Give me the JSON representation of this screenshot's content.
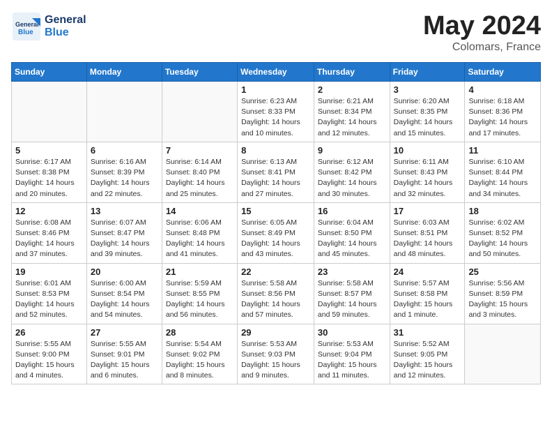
{
  "logo": {
    "general": "General",
    "blue": "Blue"
  },
  "title": "May 2024",
  "location": "Colomars, France",
  "weekdays": [
    "Sunday",
    "Monday",
    "Tuesday",
    "Wednesday",
    "Thursday",
    "Friday",
    "Saturday"
  ],
  "weeks": [
    [
      {
        "day": "",
        "info": ""
      },
      {
        "day": "",
        "info": ""
      },
      {
        "day": "",
        "info": ""
      },
      {
        "day": "1",
        "info": "Sunrise: 6:23 AM\nSunset: 8:33 PM\nDaylight: 14 hours\nand 10 minutes."
      },
      {
        "day": "2",
        "info": "Sunrise: 6:21 AM\nSunset: 8:34 PM\nDaylight: 14 hours\nand 12 minutes."
      },
      {
        "day": "3",
        "info": "Sunrise: 6:20 AM\nSunset: 8:35 PM\nDaylight: 14 hours\nand 15 minutes."
      },
      {
        "day": "4",
        "info": "Sunrise: 6:18 AM\nSunset: 8:36 PM\nDaylight: 14 hours\nand 17 minutes."
      }
    ],
    [
      {
        "day": "5",
        "info": "Sunrise: 6:17 AM\nSunset: 8:38 PM\nDaylight: 14 hours\nand 20 minutes."
      },
      {
        "day": "6",
        "info": "Sunrise: 6:16 AM\nSunset: 8:39 PM\nDaylight: 14 hours\nand 22 minutes."
      },
      {
        "day": "7",
        "info": "Sunrise: 6:14 AM\nSunset: 8:40 PM\nDaylight: 14 hours\nand 25 minutes."
      },
      {
        "day": "8",
        "info": "Sunrise: 6:13 AM\nSunset: 8:41 PM\nDaylight: 14 hours\nand 27 minutes."
      },
      {
        "day": "9",
        "info": "Sunrise: 6:12 AM\nSunset: 8:42 PM\nDaylight: 14 hours\nand 30 minutes."
      },
      {
        "day": "10",
        "info": "Sunrise: 6:11 AM\nSunset: 8:43 PM\nDaylight: 14 hours\nand 32 minutes."
      },
      {
        "day": "11",
        "info": "Sunrise: 6:10 AM\nSunset: 8:44 PM\nDaylight: 14 hours\nand 34 minutes."
      }
    ],
    [
      {
        "day": "12",
        "info": "Sunrise: 6:08 AM\nSunset: 8:46 PM\nDaylight: 14 hours\nand 37 minutes."
      },
      {
        "day": "13",
        "info": "Sunrise: 6:07 AM\nSunset: 8:47 PM\nDaylight: 14 hours\nand 39 minutes."
      },
      {
        "day": "14",
        "info": "Sunrise: 6:06 AM\nSunset: 8:48 PM\nDaylight: 14 hours\nand 41 minutes."
      },
      {
        "day": "15",
        "info": "Sunrise: 6:05 AM\nSunset: 8:49 PM\nDaylight: 14 hours\nand 43 minutes."
      },
      {
        "day": "16",
        "info": "Sunrise: 6:04 AM\nSunset: 8:50 PM\nDaylight: 14 hours\nand 45 minutes."
      },
      {
        "day": "17",
        "info": "Sunrise: 6:03 AM\nSunset: 8:51 PM\nDaylight: 14 hours\nand 48 minutes."
      },
      {
        "day": "18",
        "info": "Sunrise: 6:02 AM\nSunset: 8:52 PM\nDaylight: 14 hours\nand 50 minutes."
      }
    ],
    [
      {
        "day": "19",
        "info": "Sunrise: 6:01 AM\nSunset: 8:53 PM\nDaylight: 14 hours\nand 52 minutes."
      },
      {
        "day": "20",
        "info": "Sunrise: 6:00 AM\nSunset: 8:54 PM\nDaylight: 14 hours\nand 54 minutes."
      },
      {
        "day": "21",
        "info": "Sunrise: 5:59 AM\nSunset: 8:55 PM\nDaylight: 14 hours\nand 56 minutes."
      },
      {
        "day": "22",
        "info": "Sunrise: 5:58 AM\nSunset: 8:56 PM\nDaylight: 14 hours\nand 57 minutes."
      },
      {
        "day": "23",
        "info": "Sunrise: 5:58 AM\nSunset: 8:57 PM\nDaylight: 14 hours\nand 59 minutes."
      },
      {
        "day": "24",
        "info": "Sunrise: 5:57 AM\nSunset: 8:58 PM\nDaylight: 15 hours\nand 1 minute."
      },
      {
        "day": "25",
        "info": "Sunrise: 5:56 AM\nSunset: 8:59 PM\nDaylight: 15 hours\nand 3 minutes."
      }
    ],
    [
      {
        "day": "26",
        "info": "Sunrise: 5:55 AM\nSunset: 9:00 PM\nDaylight: 15 hours\nand 4 minutes."
      },
      {
        "day": "27",
        "info": "Sunrise: 5:55 AM\nSunset: 9:01 PM\nDaylight: 15 hours\nand 6 minutes."
      },
      {
        "day": "28",
        "info": "Sunrise: 5:54 AM\nSunset: 9:02 PM\nDaylight: 15 hours\nand 8 minutes."
      },
      {
        "day": "29",
        "info": "Sunrise: 5:53 AM\nSunset: 9:03 PM\nDaylight: 15 hours\nand 9 minutes."
      },
      {
        "day": "30",
        "info": "Sunrise: 5:53 AM\nSunset: 9:04 PM\nDaylight: 15 hours\nand 11 minutes."
      },
      {
        "day": "31",
        "info": "Sunrise: 5:52 AM\nSunset: 9:05 PM\nDaylight: 15 hours\nand 12 minutes."
      },
      {
        "day": "",
        "info": ""
      }
    ]
  ]
}
